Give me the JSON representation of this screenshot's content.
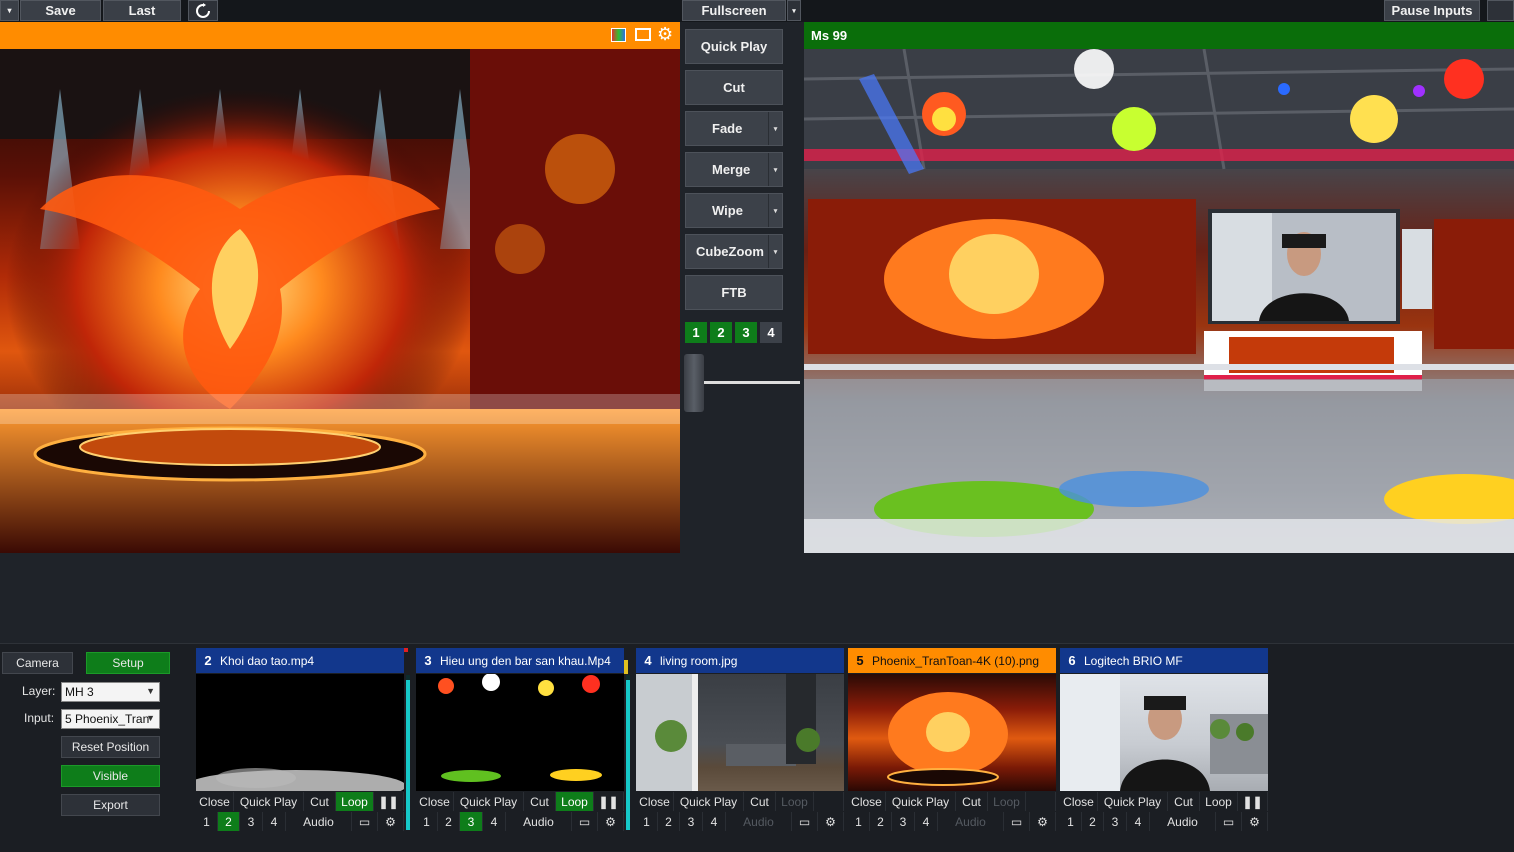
{
  "topbar": {
    "save": "Save",
    "last": "Last",
    "fullscreen": "Fullscreen",
    "pause_inputs": "Pause Inputs"
  },
  "preview": {
    "icons": [
      "color-bars-icon",
      "overlay-icon",
      "gear-icon"
    ]
  },
  "program": {
    "title": "Ms 99"
  },
  "transitions": {
    "quick_play": "Quick Play",
    "cut": "Cut",
    "fade": "Fade",
    "merge": "Merge",
    "wipe": "Wipe",
    "cubezoom": "CubeZoom",
    "ftb": "FTB",
    "numbers": [
      "1",
      "2",
      "3",
      "4"
    ],
    "t_bar_level": 0.08
  },
  "left_panel": {
    "camera": "Camera",
    "setup": "Setup",
    "layer_label": "Layer:",
    "layer_value": "MH 3",
    "input_label": "Input:",
    "input_value": "5 Phoenix_Tran",
    "reset_position": "Reset Position",
    "visible": "Visible",
    "export": "Export"
  },
  "inputs": [
    {
      "num": "2",
      "name": "Khoi dao tao.mp4",
      "active_overlay": "2",
      "loop_active": true,
      "paused_icon": true,
      "audio": "Audio"
    },
    {
      "num": "3",
      "name": "Hieu ung den bar san khau.Mp4",
      "active_overlay": "3",
      "loop_active": true,
      "paused_icon": true,
      "audio": "Audio"
    },
    {
      "num": "4",
      "name": "living room.jpg",
      "active_overlay": "",
      "loop_active": false,
      "paused_icon": false,
      "audio": "Audio"
    },
    {
      "num": "5",
      "name": "Phoenix_TranToan-4K (10).png",
      "active_overlay": "",
      "loop_active": false,
      "paused_icon": false,
      "audio": "Audio"
    },
    {
      "num": "6",
      "name": "Logitech BRIO MF",
      "active_overlay": "",
      "loop_active": false,
      "paused_icon": true,
      "audio": "Audio"
    }
  ],
  "input_controls": {
    "close": "Close",
    "quick_play": "Quick Play",
    "cut": "Cut",
    "loop": "Loop",
    "overlays": [
      "1",
      "2",
      "3",
      "4"
    ]
  },
  "colors": {
    "preview_bar": "#ff8c00",
    "program_bar": "#0a6e0a",
    "input_header": "#12378c",
    "active_green": "#0e7d1a"
  }
}
